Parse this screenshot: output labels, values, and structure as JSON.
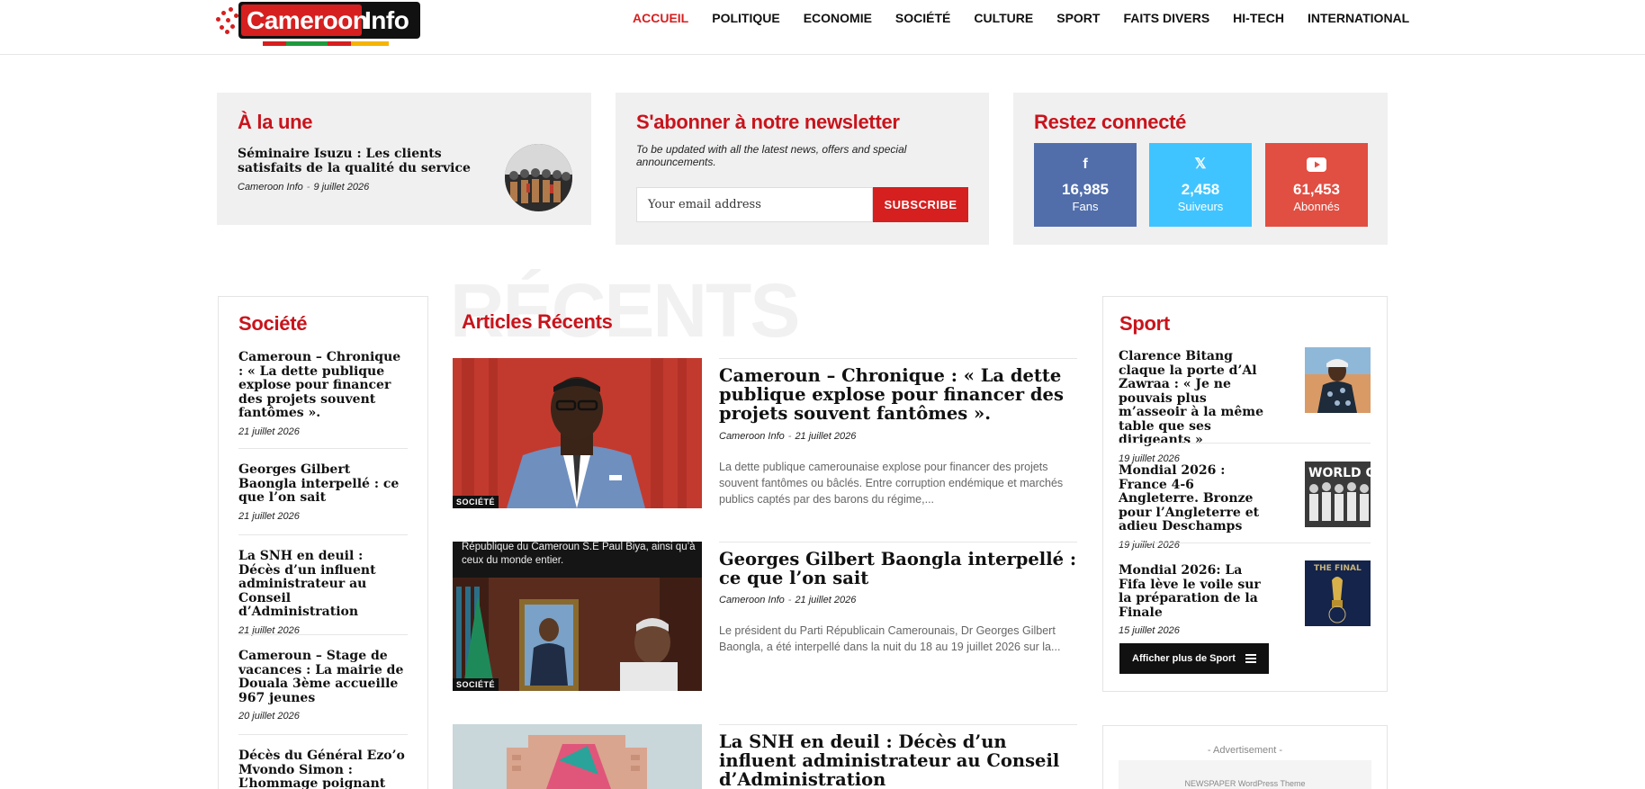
{
  "logo": {
    "part1": "Cameroon",
    "part2": "Info",
    "alt": "Cameroon Info"
  },
  "nav": [
    "ACCUEIL",
    "POLITIQUE",
    "ECONOMIE",
    "SOCIÉTÉ",
    "CULTURE",
    "SPORT",
    "FAITS DIVERS",
    "HI-TECH",
    "INTERNATIONAL"
  ],
  "une": {
    "heading": "À la une",
    "title": "Séminaire Isuzu : Les clients satisfaits de la qualité du service",
    "author": "Cameroon Info",
    "date": "9 juillet 2026"
  },
  "newsletter": {
    "heading": "S'abonner à notre newsletter",
    "desc": "To be updated with all the latest news, offers and special announcements.",
    "placeholder": "Your email address",
    "button": "SUBSCRIBE"
  },
  "social": {
    "heading": "Restez connecté",
    "items": [
      {
        "icon": "facebook-icon",
        "glyph": "f",
        "count": "16,985",
        "label": "Fans",
        "color": "#516eab"
      },
      {
        "icon": "x-icon",
        "glyph": "𝕏",
        "count": "2,458",
        "label": "Suiveurs",
        "color": "#40c4ff"
      },
      {
        "icon": "youtube-icon",
        "glyph": "▶",
        "count": "61,453",
        "label": "Abonnés",
        "color": "#e14e42"
      }
    ]
  },
  "societe": {
    "heading": "Société",
    "items": [
      {
        "title": "Cameroun – Chronique : « La dette publique explose pour financer des projets souvent fantômes ».",
        "date": "21 juillet 2026"
      },
      {
        "title": "Georges Gilbert Baongla interpellé : ce que l’on sait",
        "date": "21 juillet 2026"
      },
      {
        "title": "La SNH en deuil : Décès d’un influent administrateur au Conseil d’Administration",
        "date": "21 juillet 2026"
      },
      {
        "title": "Cameroun – Stage de vacances : La mairie de Douala 3ème accueille 967 jeunes",
        "date": "20 juillet 2026"
      },
      {
        "title": "Décès du Général Ezo’o Mvondo Simon : L’hommage poignant du",
        "date": ""
      }
    ]
  },
  "recents": {
    "bg_word": "RÉCENTS",
    "heading": "Articles Récents",
    "articles": [
      {
        "title": "Cameroun – Chronique : « La dette publique explose pour financer des projets souvent fantômes ».",
        "author": "Cameroon Info",
        "date": "21 juillet 2026",
        "excerpt": "La dette publique camerounaise explose pour financer des projets souvent fantômes ou bâclés. Entre corruption endémique et marchés publics captés par des barons du régime,...",
        "category": "SOCIÉTÉ"
      },
      {
        "title": "Georges Gilbert Baongla interpellé : ce que l’on sait",
        "author": "Cameroon Info",
        "date": "21 juillet 2026",
        "excerpt": "Le président du Parti Républicain Camerounais, Dr Georges Gilbert Baongla, a été interpellé dans la nuit du 18 au 19 juillet 2026 sur la...",
        "category": "SOCIÉTÉ",
        "img_caption": "République du Cameroun S.E Paul Biya, ainsi qu’à ceux du monde entier."
      },
      {
        "title": "La SNH en deuil : Décès d’un influent administrateur au Conseil d’Administration",
        "author": "",
        "date": "",
        "excerpt": "",
        "category": ""
      }
    ]
  },
  "sport": {
    "heading": "Sport",
    "items": [
      {
        "title": "Clarence Bitang claque la porte d’Al Zawraa : « Je ne pouvais plus m’asseoir à la même table que ses dirigeants »",
        "date": "19 juillet 2026"
      },
      {
        "title": "Mondial 2026 : France 4-6 Angleterre. Bronze pour l’Angleterre et adieu Deschamps",
        "date": "19 juillet 2026"
      },
      {
        "title": "Mondial 2026: La Fifa lève le voile sur la préparation de la Finale",
        "date": "15 juillet 2026"
      }
    ],
    "more_button": "Afficher plus de Sport"
  },
  "ad": {
    "label": "- Advertisement -",
    "text": "NEWSPAPER WordPress Theme"
  }
}
